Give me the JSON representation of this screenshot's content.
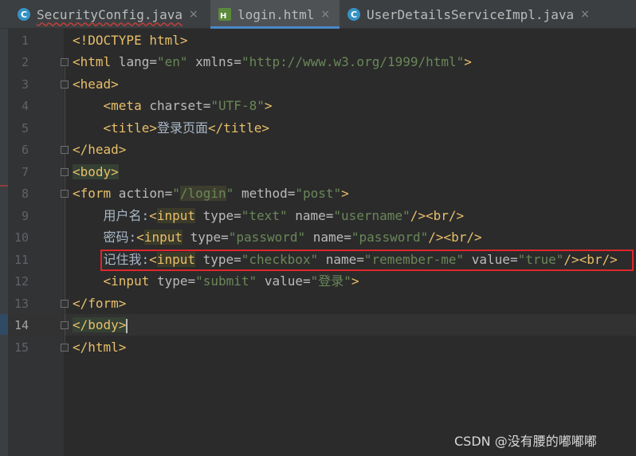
{
  "tabs": [
    {
      "label": "SecurityConfig.java",
      "icon": "java-class-icon",
      "error_underline": true
    },
    {
      "label": "login.html",
      "icon": "html-file-icon",
      "active": true
    },
    {
      "label": "UserDetailsServiceImpl.java",
      "icon": "java-class-icon"
    }
  ],
  "close_glyph": "×",
  "line_numbers": [
    "1",
    "2",
    "3",
    "4",
    "5",
    "6",
    "7",
    "8",
    "9",
    "10",
    "11",
    "12",
    "13",
    "14",
    "15"
  ],
  "current_line": "14",
  "code": {
    "l1": {
      "tag": "<!DOCTYPE html>"
    },
    "l2": {
      "open": "<html",
      "a1": " lang=",
      "v1": "\"en\"",
      "a2": " xmlns=",
      "v2": "\"http://www.w3.org/1999/html\"",
      "close": ">"
    },
    "l3": {
      "tag": "<head>"
    },
    "l4": {
      "open": "<meta",
      "a1": " charset=",
      "v1": "\"UTF-8\"",
      "close": ">"
    },
    "l5": {
      "open": "<title>",
      "text": "登录页面",
      "close": "</title>"
    },
    "l6": {
      "tag": "</head>"
    },
    "l7": {
      "tag": "<body>"
    },
    "l8": {
      "open": "<form",
      "a1": " action=",
      "v1a": "\"",
      "v1b": "/login",
      "v1c": "\"",
      "a2": " method=",
      "v2": "\"post\"",
      "close": ">"
    },
    "l9": {
      "text": "用户名:",
      "lt": "<",
      "tag": "input",
      "a1": " type=",
      "v1": "\"text\"",
      "a2": " name=",
      "v2": "\"username\"",
      "close": "/><br/>"
    },
    "l10": {
      "text": "密码:",
      "lt": "<",
      "tag": "input",
      "a1": " type=",
      "v1": "\"password\"",
      "a2": " name=",
      "v2": "\"password\"",
      "close": "/><br/>"
    },
    "l11": {
      "text": "记住我:",
      "lt": "<",
      "tag": "input",
      "a1": " type=",
      "v1": "\"checkbox\"",
      "a2": " name=",
      "v2": "\"remember-me\"",
      "a3": " value=",
      "v3": "\"true\"",
      "close": "/><br/>"
    },
    "l12": {
      "open": "<input",
      "a1": " type=",
      "v1": "\"submit\"",
      "a2": " value=",
      "v2": "\"登录\"",
      "close": ">"
    },
    "l13": {
      "tag": "</form>"
    },
    "l14": {
      "tag": "</body>"
    },
    "l15": {
      "tag": "</html>"
    }
  },
  "watermark": "CSDN @没有腰的嘟嘟嘟"
}
